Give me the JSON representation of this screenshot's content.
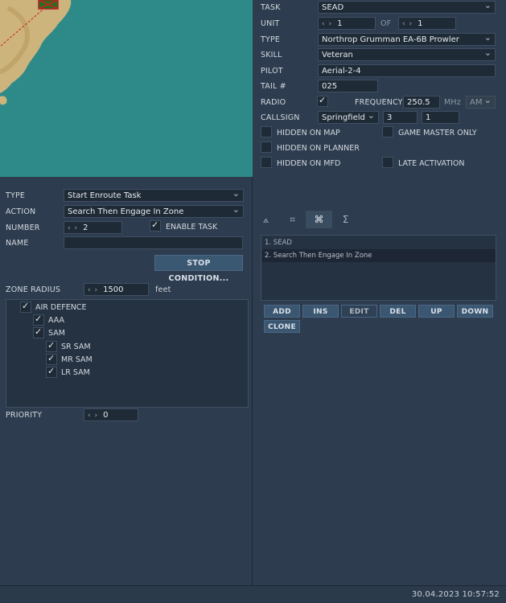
{
  "map": {
    "colors": {
      "sea": "#2e8a88",
      "land": "#d8c08a",
      "unit_marker": "#c8a020"
    }
  },
  "unit_props": {
    "task": {
      "label": "TASK",
      "value": "SEAD"
    },
    "unit": {
      "label": "UNIT",
      "value": "1",
      "of_label": "OF",
      "of_value": "1"
    },
    "type": {
      "label": "TYPE",
      "value": "Northrop Grumman EA-6B Prowler"
    },
    "skill": {
      "label": "SKILL",
      "value": "Veteran"
    },
    "pilot": {
      "label": "PILOT",
      "value": "Aerial-2-4"
    },
    "tail": {
      "label": "TAIL #",
      "value": "025"
    },
    "radio": {
      "label": "RADIO",
      "checked": true,
      "frequency_label": "FREQUENCY",
      "frequency_value": "250.5",
      "unit": "MHz",
      "modulation": "AM"
    },
    "callsign": {
      "label": "CALLSIGN",
      "name": "Springfield",
      "group": "3",
      "number": "1"
    },
    "flags": {
      "hidden_on_map": "HIDDEN ON MAP",
      "game_master_only": "GAME MASTER ONLY",
      "hidden_on_planner": "HIDDEN ON PLANNER",
      "hidden_on_mfd": "HIDDEN ON MFD",
      "late_activation": "LATE ACTIVATION"
    }
  },
  "task_editor": {
    "type": {
      "label": "TYPE",
      "value": "Start Enroute Task"
    },
    "action": {
      "label": "ACTION",
      "value": "Search Then Engage In Zone"
    },
    "number": {
      "label": "NUMBER",
      "value": "2",
      "enable_label": "ENABLE TASK",
      "enabled": true
    },
    "name": {
      "label": "NAME",
      "value": ""
    },
    "stop_condition": "STOP CONDITION...",
    "zone_radius": {
      "label": "ZONE RADIUS",
      "value": "1500",
      "unit": "feet"
    },
    "tree": {
      "air_defence": "AIR DEFENCE",
      "aaa": "AAA",
      "sam": "SAM",
      "sr_sam": "SR SAM",
      "mr_sam": "MR SAM",
      "lr_sam": "LR SAM"
    },
    "priority": {
      "label": "PRIORITY",
      "value": "0"
    }
  },
  "tasks_panel": {
    "tabs": [
      "route-icon",
      "target-icon",
      "command-icon",
      "sigma-icon"
    ],
    "tab_glyphs": [
      "⟑",
      "⌗",
      "⌘",
      "Σ"
    ],
    "tasks": [
      "1. SEAD",
      "2. Search Then Engage In Zone"
    ],
    "buttons": {
      "add": "ADD",
      "ins": "INS",
      "edit": "EDIT",
      "del": "DEL",
      "up": "UP",
      "down": "DOWN",
      "clone": "CLONE"
    }
  },
  "status": {
    "datetime": "30.04.2023 10:57:52"
  }
}
